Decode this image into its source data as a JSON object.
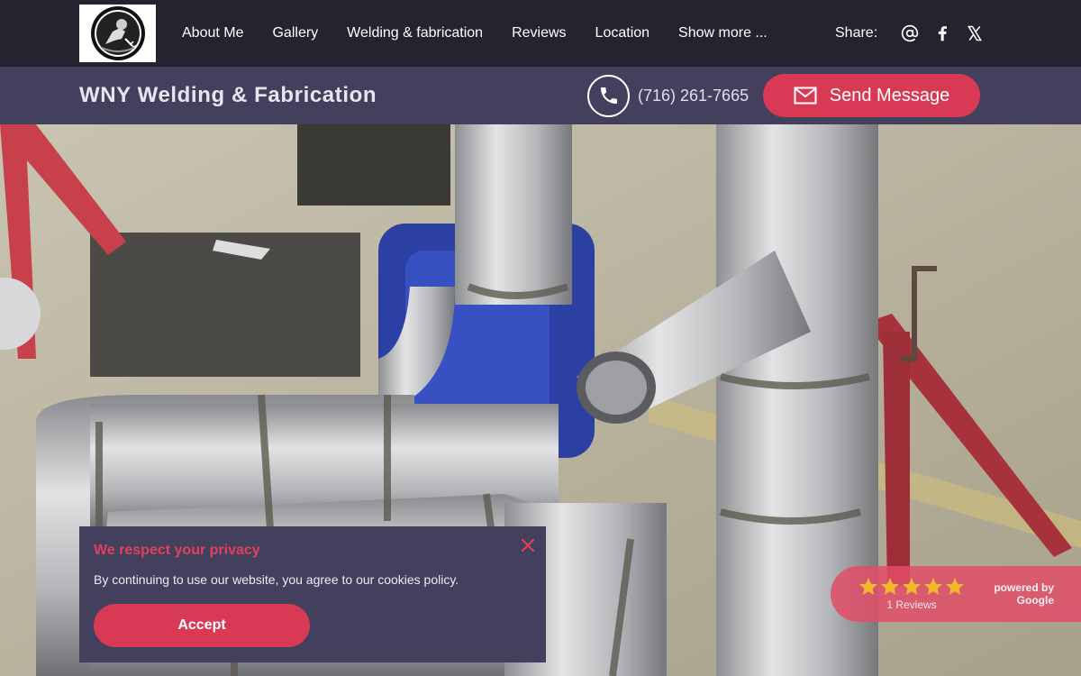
{
  "nav": {
    "logo": "welder-logo",
    "links": [
      "About Me",
      "Gallery",
      "Welding & fabrication",
      "Reviews",
      "Location",
      "Show more ..."
    ],
    "share_label": "Share:",
    "share_icons": [
      "at-icon",
      "facebook-icon",
      "x-icon"
    ]
  },
  "header": {
    "title": "WNY Welding & Fabrication",
    "phone": "(716) 261-7665",
    "send_label": "Send Message"
  },
  "hero": {
    "image": "welded-stainless-pipes-photo"
  },
  "cookie": {
    "title": "We respect your privacy",
    "text": "By continuing to use our website, you agree to our cookies policy.",
    "accept_label": "Accept"
  },
  "reviews": {
    "rating": 5,
    "count_label": "1 Reviews",
    "powered_line1": "powered by",
    "powered_line2": "Google"
  },
  "colors": {
    "accent": "#d83a55",
    "nav_bg": "#24232f",
    "subbar_bg": "#42405c",
    "title_red": "#e0405e",
    "star": "#f2b92e"
  }
}
